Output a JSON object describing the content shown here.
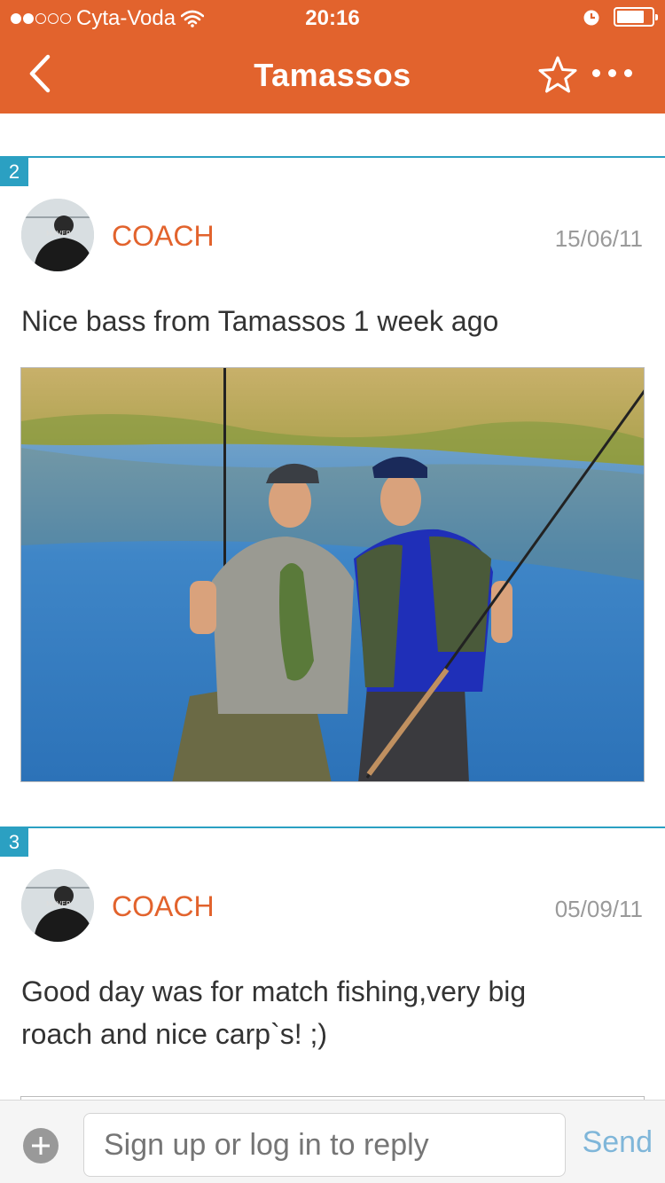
{
  "status_bar": {
    "carrier": "Cyta-Voda",
    "time": "20:16",
    "signal_bars_filled": 2,
    "signal_bars_total": 5,
    "battery_level": 0.8
  },
  "nav": {
    "title": "Tamassos",
    "back_icon": "chevron-left-icon",
    "favorite_icon": "star-outline-icon",
    "more_icon": "more-horizontal-icon"
  },
  "posts": [
    {
      "number": "2",
      "author": "COACH",
      "date": "15/06/11",
      "text": "Nice bass from Tamassos 1 week ago",
      "has_image": true
    },
    {
      "number": "3",
      "author": "COACH",
      "date": "05/09/11",
      "text": "Good day was for match fishing,very big roach and nice carp`s! ;)",
      "has_image": true
    }
  ],
  "reply": {
    "add_icon": "plus-circle-icon",
    "placeholder": "Sign up or log in to reply",
    "send_label": "Send"
  },
  "colors": {
    "header": "#e2632d",
    "accent_blue": "#2ba0c2",
    "author": "#e2632d",
    "send": "#7fb6d9"
  }
}
